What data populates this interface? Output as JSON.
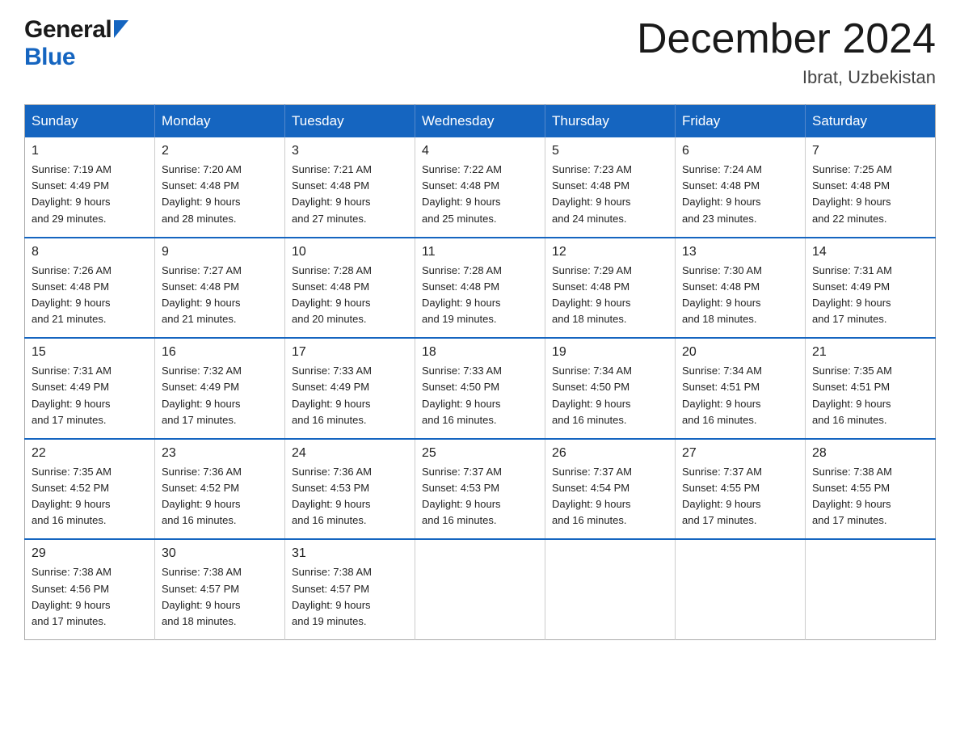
{
  "header": {
    "logo_general": "General",
    "logo_blue": "Blue",
    "month_title": "December 2024",
    "location": "Ibrat, Uzbekistan"
  },
  "calendar": {
    "days_of_week": [
      "Sunday",
      "Monday",
      "Tuesday",
      "Wednesday",
      "Thursday",
      "Friday",
      "Saturday"
    ],
    "weeks": [
      [
        {
          "day": 1,
          "sunrise": "7:19 AM",
          "sunset": "4:49 PM",
          "daylight": "9 hours and 29 minutes."
        },
        {
          "day": 2,
          "sunrise": "7:20 AM",
          "sunset": "4:48 PM",
          "daylight": "9 hours and 28 minutes."
        },
        {
          "day": 3,
          "sunrise": "7:21 AM",
          "sunset": "4:48 PM",
          "daylight": "9 hours and 27 minutes."
        },
        {
          "day": 4,
          "sunrise": "7:22 AM",
          "sunset": "4:48 PM",
          "daylight": "9 hours and 25 minutes."
        },
        {
          "day": 5,
          "sunrise": "7:23 AM",
          "sunset": "4:48 PM",
          "daylight": "9 hours and 24 minutes."
        },
        {
          "day": 6,
          "sunrise": "7:24 AM",
          "sunset": "4:48 PM",
          "daylight": "9 hours and 23 minutes."
        },
        {
          "day": 7,
          "sunrise": "7:25 AM",
          "sunset": "4:48 PM",
          "daylight": "9 hours and 22 minutes."
        }
      ],
      [
        {
          "day": 8,
          "sunrise": "7:26 AM",
          "sunset": "4:48 PM",
          "daylight": "9 hours and 21 minutes."
        },
        {
          "day": 9,
          "sunrise": "7:27 AM",
          "sunset": "4:48 PM",
          "daylight": "9 hours and 21 minutes."
        },
        {
          "day": 10,
          "sunrise": "7:28 AM",
          "sunset": "4:48 PM",
          "daylight": "9 hours and 20 minutes."
        },
        {
          "day": 11,
          "sunrise": "7:28 AM",
          "sunset": "4:48 PM",
          "daylight": "9 hours and 19 minutes."
        },
        {
          "day": 12,
          "sunrise": "7:29 AM",
          "sunset": "4:48 PM",
          "daylight": "9 hours and 18 minutes."
        },
        {
          "day": 13,
          "sunrise": "7:30 AM",
          "sunset": "4:48 PM",
          "daylight": "9 hours and 18 minutes."
        },
        {
          "day": 14,
          "sunrise": "7:31 AM",
          "sunset": "4:49 PM",
          "daylight": "9 hours and 17 minutes."
        }
      ],
      [
        {
          "day": 15,
          "sunrise": "7:31 AM",
          "sunset": "4:49 PM",
          "daylight": "9 hours and 17 minutes."
        },
        {
          "day": 16,
          "sunrise": "7:32 AM",
          "sunset": "4:49 PM",
          "daylight": "9 hours and 17 minutes."
        },
        {
          "day": 17,
          "sunrise": "7:33 AM",
          "sunset": "4:49 PM",
          "daylight": "9 hours and 16 minutes."
        },
        {
          "day": 18,
          "sunrise": "7:33 AM",
          "sunset": "4:50 PM",
          "daylight": "9 hours and 16 minutes."
        },
        {
          "day": 19,
          "sunrise": "7:34 AM",
          "sunset": "4:50 PM",
          "daylight": "9 hours and 16 minutes."
        },
        {
          "day": 20,
          "sunrise": "7:34 AM",
          "sunset": "4:51 PM",
          "daylight": "9 hours and 16 minutes."
        },
        {
          "day": 21,
          "sunrise": "7:35 AM",
          "sunset": "4:51 PM",
          "daylight": "9 hours and 16 minutes."
        }
      ],
      [
        {
          "day": 22,
          "sunrise": "7:35 AM",
          "sunset": "4:52 PM",
          "daylight": "9 hours and 16 minutes."
        },
        {
          "day": 23,
          "sunrise": "7:36 AM",
          "sunset": "4:52 PM",
          "daylight": "9 hours and 16 minutes."
        },
        {
          "day": 24,
          "sunrise": "7:36 AM",
          "sunset": "4:53 PM",
          "daylight": "9 hours and 16 minutes."
        },
        {
          "day": 25,
          "sunrise": "7:37 AM",
          "sunset": "4:53 PM",
          "daylight": "9 hours and 16 minutes."
        },
        {
          "day": 26,
          "sunrise": "7:37 AM",
          "sunset": "4:54 PM",
          "daylight": "9 hours and 16 minutes."
        },
        {
          "day": 27,
          "sunrise": "7:37 AM",
          "sunset": "4:55 PM",
          "daylight": "9 hours and 17 minutes."
        },
        {
          "day": 28,
          "sunrise": "7:38 AM",
          "sunset": "4:55 PM",
          "daylight": "9 hours and 17 minutes."
        }
      ],
      [
        {
          "day": 29,
          "sunrise": "7:38 AM",
          "sunset": "4:56 PM",
          "daylight": "9 hours and 17 minutes."
        },
        {
          "day": 30,
          "sunrise": "7:38 AM",
          "sunset": "4:57 PM",
          "daylight": "9 hours and 18 minutes."
        },
        {
          "day": 31,
          "sunrise": "7:38 AM",
          "sunset": "4:57 PM",
          "daylight": "9 hours and 19 minutes."
        },
        null,
        null,
        null,
        null
      ]
    ]
  }
}
